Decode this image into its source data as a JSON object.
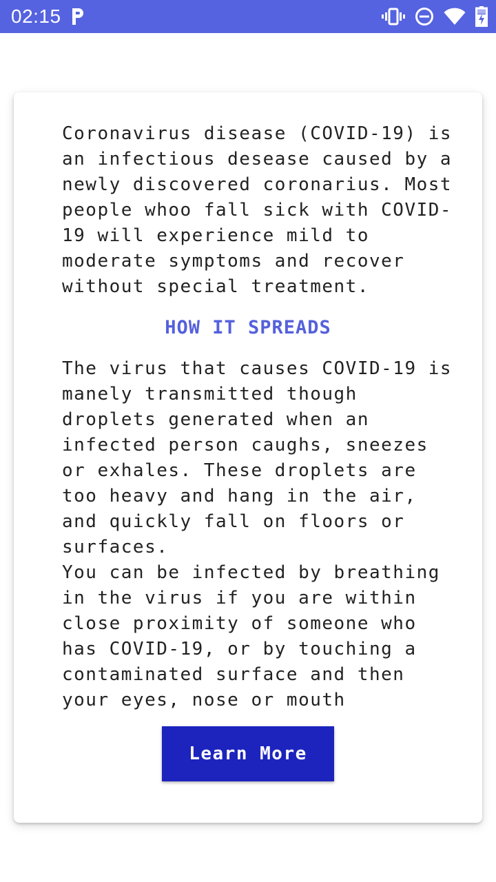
{
  "status_bar": {
    "time": "02:15",
    "background_color": "#5563e0",
    "icons": [
      "parking-icon",
      "vibrate-icon",
      "do-not-disturb-icon",
      "wifi-icon",
      "battery-charging-icon"
    ]
  },
  "card": {
    "intro": "Coronavirus disease (COVID-19) is an infectious desease caused by a newly discovered coronarius. Most people whoo fall sick with COVID-19 will experience mild to moderate symptoms and recover without special treatment.",
    "heading": "HOW IT SPREADS",
    "heading_color": "#5560dc",
    "spread": "The virus that causes COVID-19 is manely transmitted though droplets generated when an infected person caughs, sneezes or exhales. These droplets are too heavy and hang in the air, and quickly fall on floors or surfaces.",
    "infect": "You can be infected by breathing in the virus if you are within close proximity of someone who has COVID-19, or by touching a contaminated surface and then your eyes, nose or mouth",
    "button_label": "Learn More",
    "button_color": "#1c24bd"
  }
}
